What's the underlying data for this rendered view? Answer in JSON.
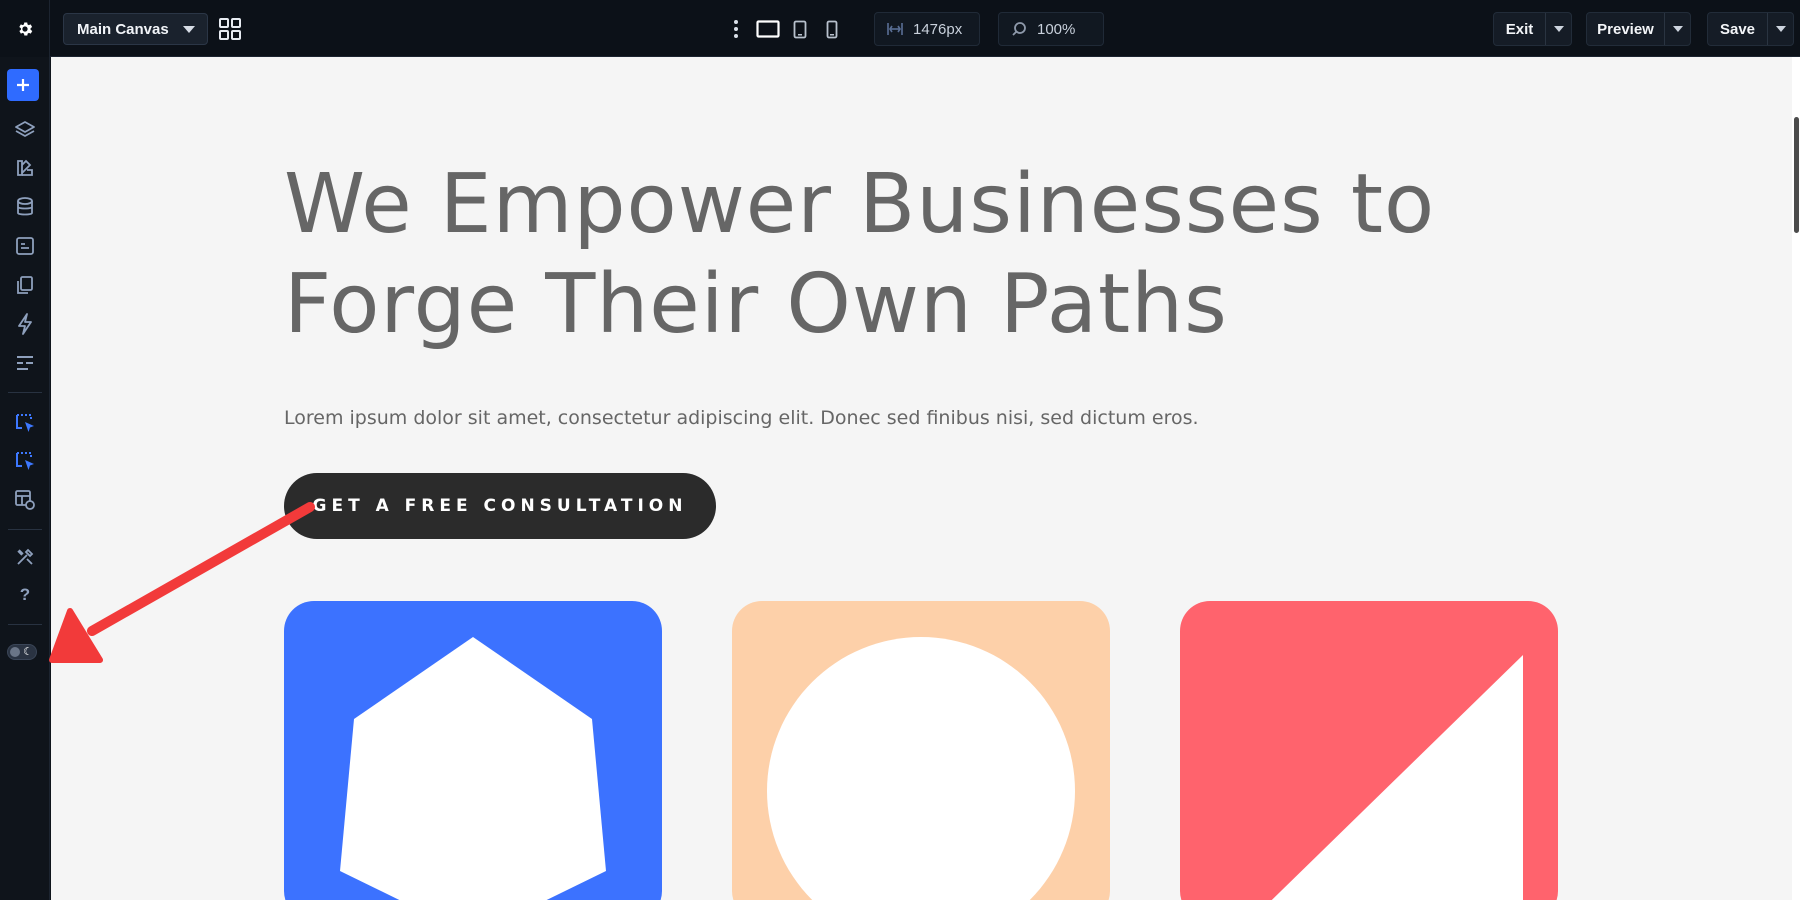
{
  "toolbar": {
    "canvas_select": "Main Canvas",
    "width_value": "1476px",
    "zoom_value": "100%",
    "exit_label": "Exit",
    "preview_label": "Preview",
    "save_label": "Save"
  },
  "sidebar": {
    "icons": [
      "plus-icon",
      "layers-icon",
      "theme-icon",
      "database-icon",
      "form-icon",
      "pages-icon",
      "lightning-icon",
      "lines-icon",
      "cursor-select-icon",
      "cursor-select-active-icon",
      "template-settings-icon",
      "tools-icon",
      "help-icon"
    ],
    "help_label": "?",
    "mode_toggle": "dark-mode"
  },
  "canvas": {
    "headline_line1": "We Empower Businesses to",
    "headline_line2": "Forge Their Own Paths",
    "subtext": "Lorem ipsum dolor sit amet, consectetur adipiscing elit. Donec sed finibus nisi, sed dictum eros.",
    "cta_label": "GET A FREE CONSULTATION",
    "cards": [
      {
        "shape": "hexagon",
        "color": "#3c72ff"
      },
      {
        "shape": "circle",
        "color": "#fdd0a9"
      },
      {
        "shape": "triangle",
        "color": "#ff636d"
      }
    ]
  },
  "colors": {
    "accent": "#2f6bff",
    "annotation_arrow": "#f23a3a",
    "headline": "#666666",
    "cta_bg": "#2b2b2b"
  }
}
